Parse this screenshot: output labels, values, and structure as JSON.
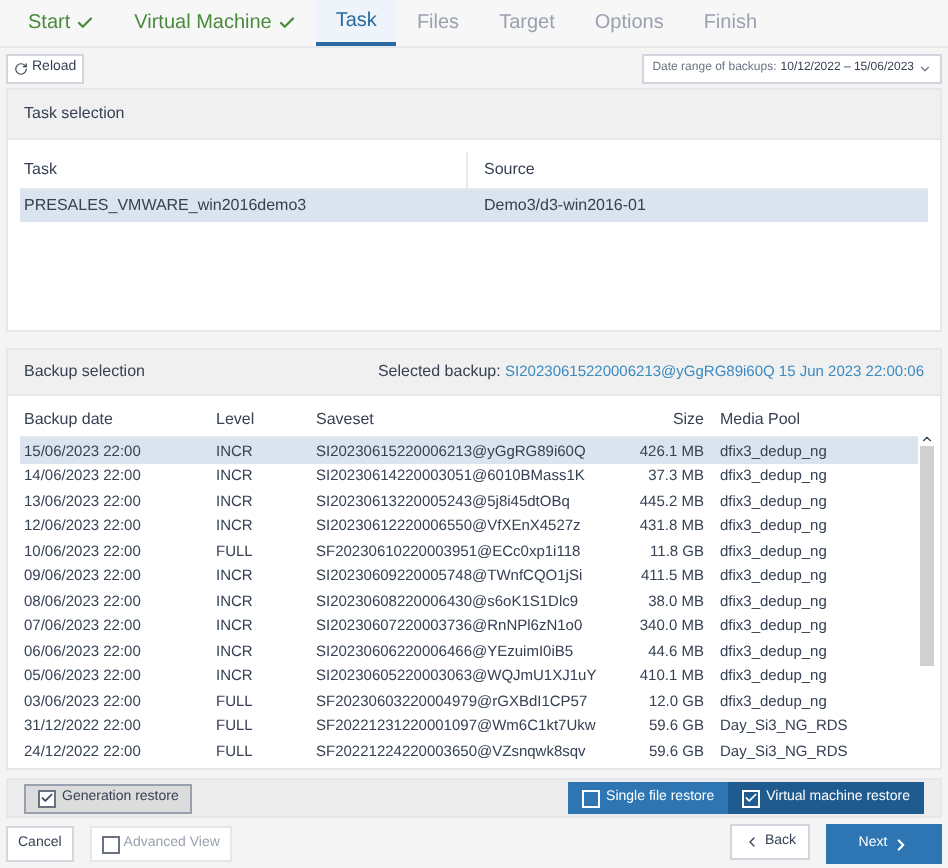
{
  "steps": [
    {
      "label": "Start",
      "kind": "done"
    },
    {
      "label": "Virtual Machine",
      "kind": "done"
    },
    {
      "label": "Task",
      "kind": "active"
    },
    {
      "label": "Files",
      "kind": "pending"
    },
    {
      "label": "Target",
      "kind": "pending"
    },
    {
      "label": "Options",
      "kind": "pending"
    },
    {
      "label": "Finish",
      "kind": "pending"
    }
  ],
  "toolbar": {
    "reload": "Reload",
    "date_range_label": "Date range of backups:",
    "date_range_value": "10/12/2022 – 15/06/2023"
  },
  "task_selection": {
    "title": "Task selection",
    "columns": [
      "Task",
      "Source"
    ],
    "rows": [
      {
        "cells": [
          "PRESALES_VMWARE_win2016demo3",
          "Demo3/d3-win2016-01"
        ],
        "selected": true
      }
    ]
  },
  "backup_selection": {
    "title": "Backup selection",
    "selected_label": "Selected backup:",
    "selected_value": "SI20230615220006213@yGgRG89i60Q 15 Jun 2023 22:00:06",
    "columns": [
      "Backup date",
      "Level",
      "Saveset",
      "Size",
      "Media Pool"
    ],
    "rows": [
      {
        "cells": [
          "15/06/2023 22:00",
          "INCR",
          "SI20230615220006213@yGgRG89i60Q",
          "426.1 MB",
          "dfix3_dedup_ng"
        ],
        "selected": true
      },
      {
        "cells": [
          "14/06/2023 22:00",
          "INCR",
          "SI20230614220003051@6010BMass1K",
          "37.3 MB",
          "dfix3_dedup_ng"
        ],
        "selected": false
      },
      {
        "cells": [
          "13/06/2023 22:00",
          "INCR",
          "SI20230613220005243@5j8i45dtOBq",
          "445.2 MB",
          "dfix3_dedup_ng"
        ],
        "selected": false
      },
      {
        "cells": [
          "12/06/2023 22:00",
          "INCR",
          "SI20230612220006550@VfXEnX4527z",
          "431.8 MB",
          "dfix3_dedup_ng"
        ],
        "selected": false
      },
      {
        "cells": [
          "10/06/2023 22:00",
          "FULL",
          "SF20230610220003951@ECc0xp1i118",
          "11.8 GB",
          "dfix3_dedup_ng"
        ],
        "selected": false
      },
      {
        "cells": [
          "09/06/2023 22:00",
          "INCR",
          "SI20230609220005748@TWnfCQO1jSi",
          "411.5 MB",
          "dfix3_dedup_ng"
        ],
        "selected": false
      },
      {
        "cells": [
          "08/06/2023 22:00",
          "INCR",
          "SI20230608220006430@s6oK1S1Dlc9",
          "38.0 MB",
          "dfix3_dedup_ng"
        ],
        "selected": false
      },
      {
        "cells": [
          "07/06/2023 22:00",
          "INCR",
          "SI20230607220003736@RnNPl6zN1o0",
          "340.0 MB",
          "dfix3_dedup_ng"
        ],
        "selected": false
      },
      {
        "cells": [
          "06/06/2023 22:00",
          "INCR",
          "SI20230606220006466@YEzuimI0iB5",
          "44.6 MB",
          "dfix3_dedup_ng"
        ],
        "selected": false
      },
      {
        "cells": [
          "05/06/2023 22:00",
          "INCR",
          "SI20230605220003063@WQJmU1XJ1uY",
          "410.1 MB",
          "dfix3_dedup_ng"
        ],
        "selected": false
      },
      {
        "cells": [
          "03/06/2023 22:00",
          "FULL",
          "SF20230603220004979@rGXBdI1CP57",
          "12.0 GB",
          "dfix3_dedup_ng"
        ],
        "selected": false
      },
      {
        "cells": [
          "31/12/2022 22:00",
          "FULL",
          "SF20221231220001097@Wm6C1kt7Ukw",
          "59.6 GB",
          "Day_Si3_NG_RDS"
        ],
        "selected": false
      },
      {
        "cells": [
          "24/12/2022 22:00",
          "FULL",
          "SF20221224220003650@VZsnqwk8sqv",
          "59.6 GB",
          "Day_Si3_NG_RDS"
        ],
        "selected": false
      }
    ]
  },
  "restore": {
    "generation": {
      "label": "Generation restore",
      "checked": true
    },
    "modes": [
      {
        "label": "Single file restore",
        "checked": false
      },
      {
        "label": "Virtual machine restore",
        "checked": true
      }
    ]
  },
  "footer": {
    "cancel": "Cancel",
    "advanced": {
      "label": "Advanced View",
      "checked": false
    },
    "back": "Back",
    "next": "Next"
  }
}
